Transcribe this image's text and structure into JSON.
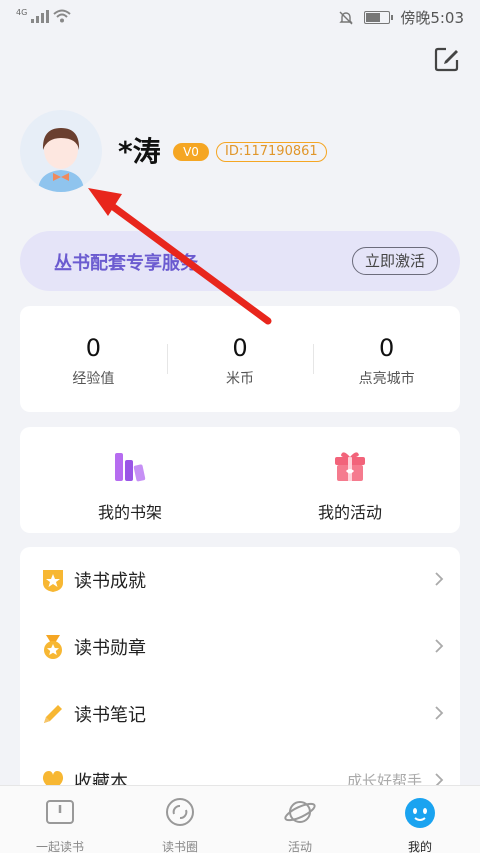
{
  "status_bar": {
    "network": "4G",
    "time": "傍晚5:03"
  },
  "profile": {
    "username": "*涛",
    "level": "V0",
    "id_text": "ID:117190861"
  },
  "promo": {
    "text": "丛书配套专享服务",
    "button": "立即激活"
  },
  "stats": [
    {
      "value": "0",
      "label": "经验值"
    },
    {
      "value": "0",
      "label": "米币"
    },
    {
      "value": "0",
      "label": "点亮城市"
    }
  ],
  "shortcuts": [
    {
      "label": "我的书架",
      "icon": "bookshelf-icon"
    },
    {
      "label": "我的活动",
      "icon": "gift-icon"
    }
  ],
  "menu": [
    {
      "label": "读书成就",
      "value": "",
      "icon": "shield-star-icon"
    },
    {
      "label": "读书勋章",
      "value": "",
      "icon": "medal-icon"
    },
    {
      "label": "读书笔记",
      "value": "",
      "icon": "pencil-icon"
    },
    {
      "label": "收藏本",
      "value": "成长好帮手",
      "icon": "heart-icon"
    }
  ],
  "tabs": [
    {
      "label": "一起读书",
      "icon": "book-icon",
      "active": false
    },
    {
      "label": "读书圈",
      "icon": "circle-icon",
      "active": false
    },
    {
      "label": "活动",
      "icon": "planet-icon",
      "active": false
    },
    {
      "label": "我的",
      "icon": "mascot-icon",
      "active": true
    }
  ],
  "colors": {
    "accent": "#6b5bd0",
    "badge": "#f5a623",
    "annotation": "#e8261c",
    "active_tab": "#1aa3f0"
  }
}
